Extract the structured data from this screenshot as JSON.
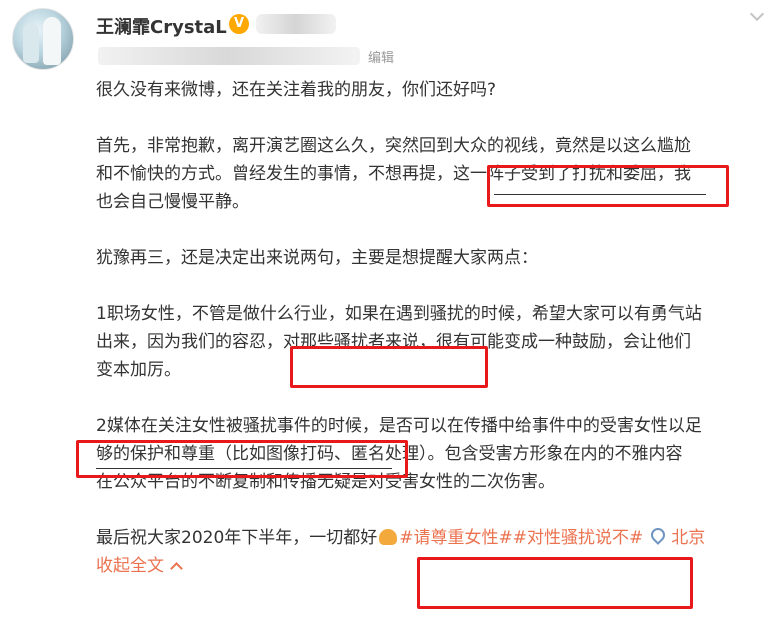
{
  "user": {
    "name": "王澜霏CrystaL",
    "badge": "V"
  },
  "meta": {
    "edit_label": "编辑"
  },
  "post": {
    "line1": "很久没有来微博，还在关注着我的朋友，你们还好吗?",
    "p2_line1": "首先，非常抱歉，离开演艺圈这么久，突然回到大众的视线，竟然是以这么尴尬",
    "p2_line2_a": "和不愉快的方式。曾经发生的事情，不想再提，",
    "p2_line2_b": "这一阵子受到了打扰和委屈",
    "p2_line2_c": "，我",
    "p2_line3": "也会自己慢慢平静。",
    "p3_line1": "犹豫再三，还是决定出来说两句，主要是想提醒大家两点：",
    "p4_line1": "1职场女性，不管是做什么行业，如果在遇到骚扰的时候，希望大家可以有勇气站",
    "p4_line2_a": "出来，因为我们的容忍，",
    "p4_line2_b": "对那些骚扰者来说，",
    "p4_line2_c": "很有可能变成一种鼓励，会让他们",
    "p4_line3": "变本加厉。",
    "p5_line1_a": "2媒体在关注女性被骚扰事件的时候",
    "p5_line1_b": "，是否可以在传播中给事件中的受害女性以足",
    "p5_line2": "够的保护和尊重（比如图像打码、匿名处理）。包含受害方形象在内的不雅内容",
    "p5_line3": "在公众平台的不断复制和传播无疑是对受害女性的二次伤害。",
    "p6_text": "最后祝大家2020年下半年，一切都好",
    "hashtag1": "#请尊重女性#",
    "hashtag2": "#对性骚扰说不#",
    "location": "北京",
    "collapse_label": "收起全文"
  },
  "icons": {
    "verified": "verified-badge-icon",
    "chevron": "chevron-down-icon",
    "location": "location-pin-icon",
    "emoji": "pray-hands-emoji-icon",
    "collapse": "chevron-up-icon"
  },
  "colors": {
    "text": "#333333",
    "link": "#eb7350",
    "annotation_red": "#e8191b",
    "verified": "#ffa800",
    "location_icon": "#6f95c0"
  }
}
